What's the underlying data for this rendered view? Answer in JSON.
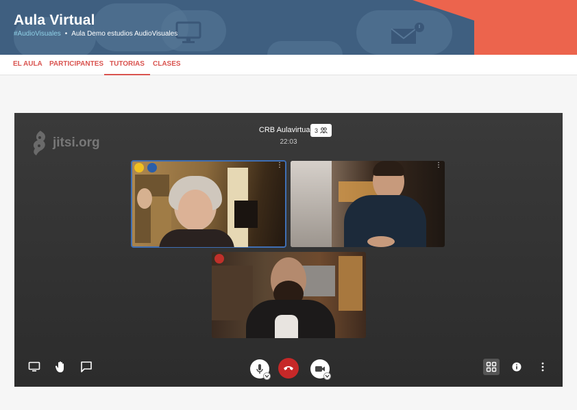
{
  "banner": {
    "title": "Aula Virtual",
    "tag": "#AudioVisuales",
    "separator": "•",
    "subtitle": "Aula Demo estudios AudioVisuales"
  },
  "nav": {
    "tabs": [
      {
        "label": "EL AULA",
        "active": false
      },
      {
        "label": "PARTICIPANTES",
        "active": false
      },
      {
        "label": "TUTORIAS",
        "active": true
      },
      {
        "label": "CLASES",
        "active": false
      }
    ]
  },
  "meeting": {
    "watermark": "jitsi.org",
    "room_name": "CRB Aulavirtual 1",
    "timer": "22:03",
    "participant_count": "3"
  },
  "toolbar": {
    "left": [
      "screen-share-icon",
      "raise-hand-icon",
      "chat-icon"
    ],
    "center": [
      "microphone-icon",
      "hangup-icon",
      "camera-icon"
    ],
    "right": [
      "tile-view-icon",
      "info-icon",
      "more-icon"
    ]
  },
  "colors": {
    "accent": "#d9534f",
    "banner": "#3f5f80",
    "orange": "#ec644d",
    "hangup": "#c62828",
    "active_tile": "#3f6fb5"
  }
}
